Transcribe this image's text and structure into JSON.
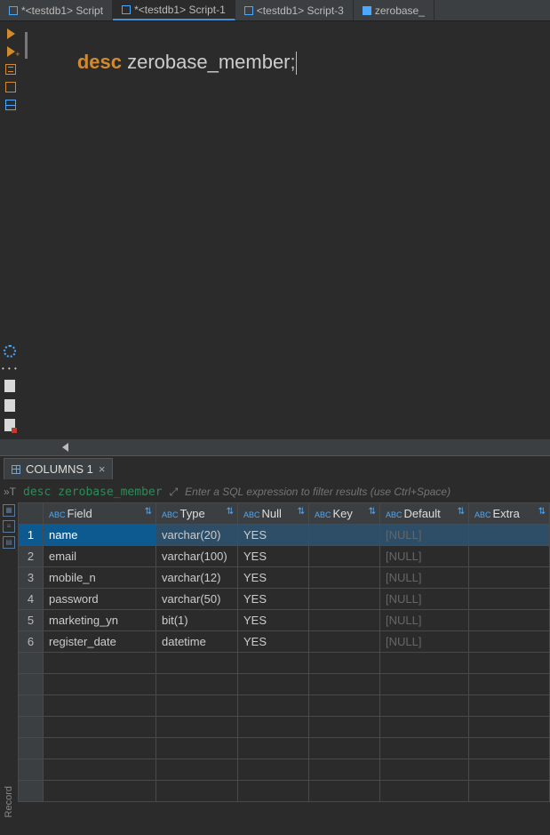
{
  "tabs": [
    {
      "label": "*<testdb1> Script"
    },
    {
      "label": "*<testdb1> Script-1"
    },
    {
      "label": "<testdb1> Script-3"
    },
    {
      "label": "zerobase_"
    }
  ],
  "editor": {
    "keyword": "desc",
    "rest": " zerobase_member",
    "semicolon": ";"
  },
  "resultTab": {
    "label": "COLUMNS 1",
    "close": "×"
  },
  "filter": {
    "query": "desc zerobase_member",
    "placeholder": "Enter a SQL expression to filter results (use Ctrl+Space)"
  },
  "columns": [
    "Field",
    "Type",
    "Null",
    "Key",
    "Default",
    "Extra"
  ],
  "colPrefix": "ABC",
  "rows": [
    {
      "n": "1",
      "Field": "name",
      "Type": "varchar(20)",
      "Null": "YES",
      "Key": "",
      "Default": "[NULL]",
      "Extra": ""
    },
    {
      "n": "2",
      "Field": "email",
      "Type": "varchar(100)",
      "Null": "YES",
      "Key": "",
      "Default": "[NULL]",
      "Extra": ""
    },
    {
      "n": "3",
      "Field": "mobile_n",
      "Type": "varchar(12)",
      "Null": "YES",
      "Key": "",
      "Default": "[NULL]",
      "Extra": ""
    },
    {
      "n": "4",
      "Field": "password",
      "Type": "varchar(50)",
      "Null": "YES",
      "Key": "",
      "Default": "[NULL]",
      "Extra": ""
    },
    {
      "n": "5",
      "Field": "marketing_yn",
      "Type": "bit(1)",
      "Null": "YES",
      "Key": "",
      "Default": "[NULL]",
      "Extra": ""
    },
    {
      "n": "6",
      "Field": "register_date",
      "Type": "datetime",
      "Null": "YES",
      "Key": "",
      "Default": "[NULL]",
      "Extra": ""
    }
  ],
  "empty": "",
  "recordLabel": "Record"
}
